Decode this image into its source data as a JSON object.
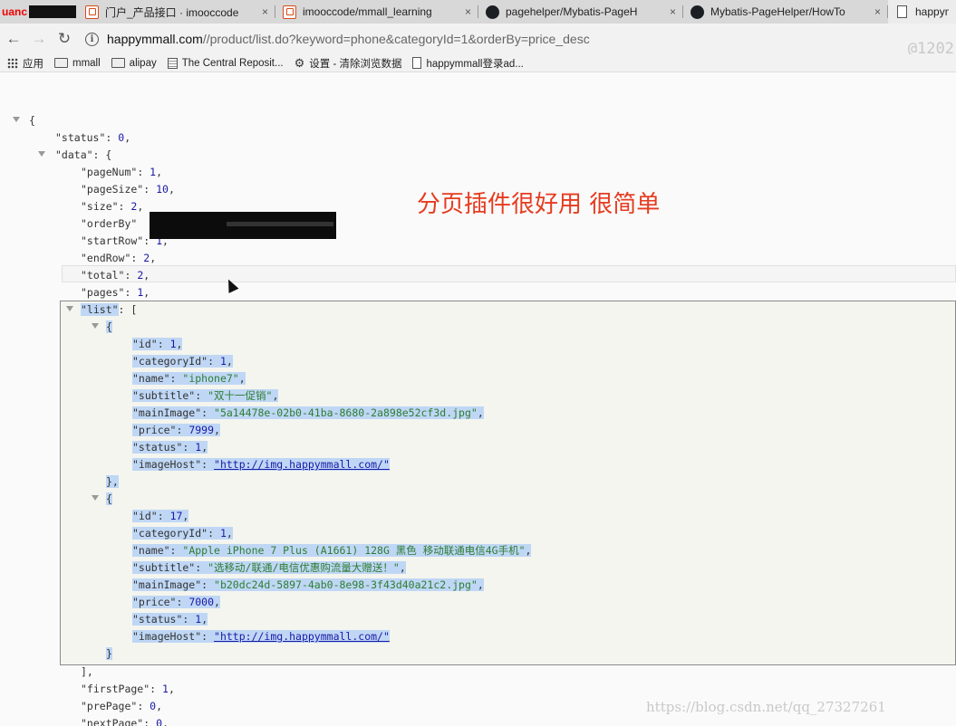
{
  "browser": {
    "tabs": [
      {
        "title": "uanc",
        "type": "label"
      },
      {
        "title": "门户_产品接口 · imooccode",
        "icon": "imooc-icon"
      },
      {
        "title": "imooccode/mmall_learning",
        "icon": "imooc-icon"
      },
      {
        "title": "pagehelper/Mybatis-PageH",
        "icon": "github-icon"
      },
      {
        "title": "Mybatis-PageHelper/HowTo",
        "icon": "github-icon"
      },
      {
        "title": "happym",
        "icon": "document-icon"
      }
    ],
    "close_glyph": "×",
    "url_host": "happymmall.com",
    "url_path": "//product/list.do?keyword=phone&categoryId=1&orderBy=price_desc",
    "overlay_text": "@1202",
    "bookmarks": [
      {
        "label": "应用",
        "icon": "apps-icon"
      },
      {
        "label": "mmall",
        "icon": "folder-icon"
      },
      {
        "label": "alipay",
        "icon": "folder-icon"
      },
      {
        "label": "The Central Reposit...",
        "icon": "book-icon"
      },
      {
        "label": "设置 - 清除浏览数据",
        "icon": "gear-icon"
      },
      {
        "label": "happymmall登录ad...",
        "icon": "page-icon"
      }
    ]
  },
  "json_view": {
    "open_brace": "{",
    "status_key": "\"status\"",
    "status_val": "0",
    "data_key": "\"data\"",
    "pageNum_key": "\"pageNum\"",
    "pageNum_val": "1",
    "pageSize_key": "\"pageSize\"",
    "pageSize_val": "10",
    "size_key": "\"size\"",
    "size_val": "2",
    "orderBy_key": "\"orderBy\"",
    "startRow_key": "\"startRow\"",
    "startRow_val": "1",
    "endRow_key": "\"endRow\"",
    "endRow_val": "2",
    "total_key": "\"total\"",
    "total_val": "2",
    "pages_key": "\"pages\"",
    "pages_val": "1",
    "list_key": "\"list\"",
    "items": [
      {
        "id": "1",
        "categoryId": "1",
        "name": "\"iphone7\"",
        "subtitle": "\"双十一促销\"",
        "mainImage": "\"5a14478e-02b0-41ba-8680-2a898e52cf3d.jpg\"",
        "price": "7999",
        "status": "1",
        "imageHost": "\"http://img.happymmall.com/\""
      },
      {
        "id": "17",
        "categoryId": "1",
        "name": "\"Apple iPhone 7 Plus (A1661) 128G 黑色 移动联通电信4G手机\"",
        "subtitle": "\"选移动/联通/电信优惠购流量大赠送！\"",
        "mainImage": "\"b20dc24d-5897-4ab0-8e98-3f43d40a21c2.jpg\"",
        "price": "7000",
        "status": "1",
        "imageHost": "\"http://img.happymmall.com/\""
      }
    ],
    "firstPage_key": "\"firstPage\"",
    "firstPage_val": "1",
    "prePage_key": "\"prePage\"",
    "prePage_val": "0",
    "nextPage_key": "\"nextPage\"",
    "nextPage_val": "0"
  },
  "annotation": "分页插件很好用  很简单",
  "watermark": "https://blog.csdn.net/qq_27327261"
}
